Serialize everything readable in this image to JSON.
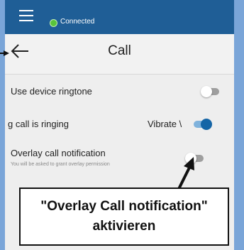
{
  "status": {
    "connection_text": "Connected",
    "connection_color": "#59c43b",
    "icons": [
      "menu-icon"
    ]
  },
  "appbar": {
    "title": "Call",
    "back_icon": "arrow-left-icon"
  },
  "settings": [
    {
      "label": "Use device ringtone",
      "toggle": "off"
    },
    {
      "label": "g call is ringing",
      "value": "Vibrate \\",
      "toggle": "on"
    },
    {
      "label": "Overlay call notification",
      "sublabel": "You will be asked to grant overlay permission",
      "toggle": "off"
    }
  ],
  "annotation": {
    "line1": "\"Overlay Call notification\"",
    "line2": "aktivieren"
  },
  "colors": {
    "statusbar": "#1f5e96",
    "accent": "#1565a6",
    "frame": "#7aa5d8"
  }
}
